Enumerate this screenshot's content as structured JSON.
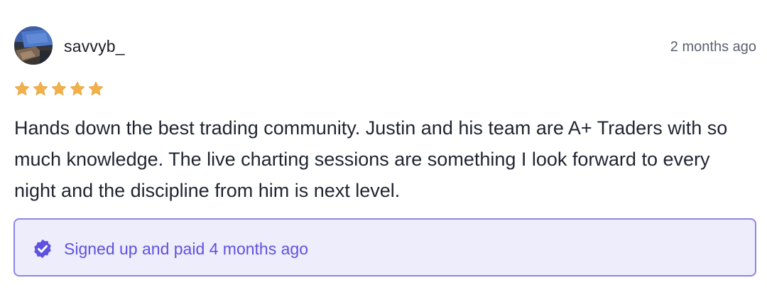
{
  "review": {
    "username": "savvyb_",
    "timestamp": "2 months ago",
    "rating": 5,
    "rating_max": 5,
    "star_color": "#f2b04b",
    "body": "Hands down the best trading community. Justin and his team are A+ Traders with so much knowledge. The live charting sessions are something I look forward to every night and the discipline from him is next level.",
    "verified": {
      "icon": "verified-badge-icon",
      "text": "Signed up and paid 4 months ago",
      "text_color": "#5e52e0",
      "border_color": "#8b86e8",
      "background_color": "#eeedfb"
    }
  }
}
